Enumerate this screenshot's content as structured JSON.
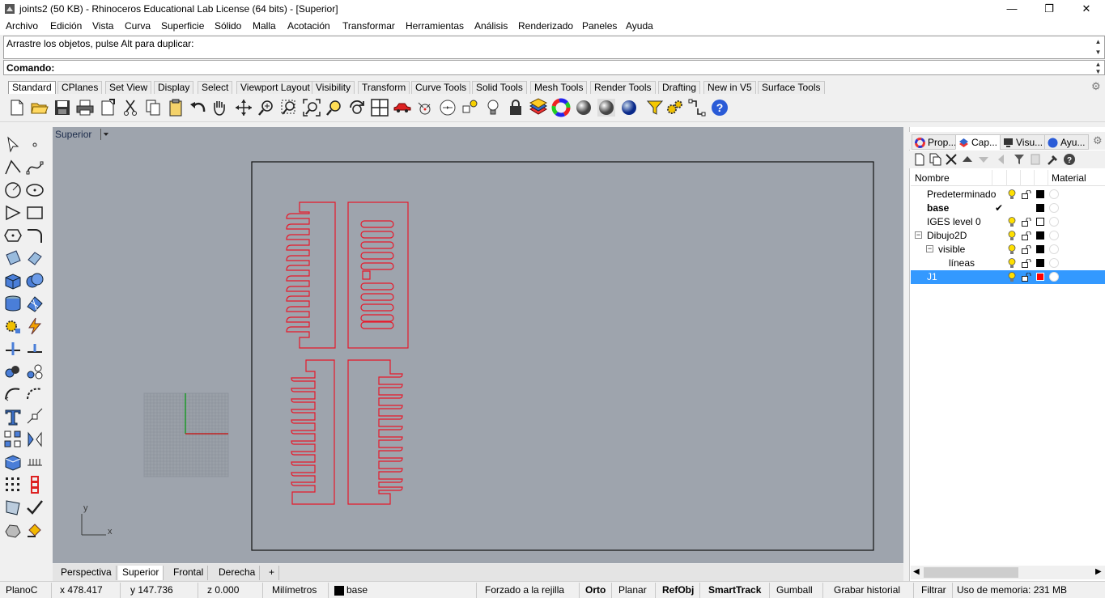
{
  "window": {
    "title": "joints2 (50 KB) - Rhinoceros Educational Lab License (64 bits) - [Superior]",
    "minimize": "—",
    "restore": "❐",
    "close": "✕"
  },
  "menu": [
    "Archivo",
    "Edición",
    "Vista",
    "Curva",
    "Superficie",
    "Sólido",
    "Malla",
    "Acotación",
    "Transformar",
    "Herramientas",
    "Análisis",
    "Renderizado",
    "Paneles",
    "Ayuda"
  ],
  "command": {
    "history": "Arrastre los objetos, pulse Alt para duplicar:",
    "prompt": "Comando:"
  },
  "toolbar_tabs": [
    "Standard",
    "CPlanes",
    "Set View",
    "Display",
    "Select",
    "Viewport Layout",
    "Visibility",
    "Transform",
    "Curve Tools",
    "Solid Tools",
    "Mesh Tools",
    "Render Tools",
    "Drafting",
    "New in V5",
    "Surface Tools"
  ],
  "toolbar_icons": [
    "new-file-icon",
    "open-folder-icon",
    "save-icon",
    "print-icon",
    "import-icon",
    "cut-icon",
    "copy-icon",
    "paste-icon",
    "undo-icon",
    "pan-hand-icon",
    "move-view-icon",
    "zoom-icon",
    "zoom-window-icon",
    "zoom-extents-icon",
    "zoom-selected-icon",
    "rotate-view-icon",
    "four-viewports-icon",
    "car-icon",
    "camera-target-icon",
    "cplane-icon",
    "point-select-icon",
    "light-bulb-icon",
    "lock-icon",
    "layer-icon",
    "color-wheel-icon",
    "shaded-sphere-icon",
    "rendered-sphere-icon",
    "ghosted-sphere-icon",
    "blue-sphere-icon",
    "filter-icon",
    "options-gears-icon",
    "snap-icon",
    "help-icon"
  ],
  "viewport": {
    "name": "Superior",
    "axis_x": "x",
    "axis_y": "y",
    "tabs": [
      "Perspectiva",
      "Superior",
      "Frontal",
      "Derecha"
    ],
    "add_tab": "+"
  },
  "panel": {
    "tabs": [
      "Prop...",
      "Cap...",
      "Visu...",
      "Ayu..."
    ],
    "columns": {
      "name": "Nombre",
      "material": "Material"
    },
    "layers": [
      {
        "name": "Predeterminado",
        "indent": 0,
        "bold": false,
        "color": "#000000",
        "current": false,
        "selected": false
      },
      {
        "name": "base",
        "indent": 0,
        "bold": true,
        "color": "#000000",
        "current": true,
        "selected": false
      },
      {
        "name": "IGES level 0",
        "indent": 0,
        "bold": false,
        "color": "#ffffff",
        "current": false,
        "selected": false
      },
      {
        "name": "Dibujo2D",
        "indent": 0,
        "bold": false,
        "color": "#000000",
        "current": false,
        "selected": false,
        "tree": "⊟"
      },
      {
        "name": "visible",
        "indent": 1,
        "bold": false,
        "color": "#000000",
        "current": false,
        "selected": false,
        "tree": "⊟"
      },
      {
        "name": "líneas",
        "indent": 2,
        "bold": false,
        "color": "#000000",
        "current": false,
        "selected": false
      },
      {
        "name": "J1",
        "indent": 0,
        "bold": false,
        "color": "#ff0000",
        "current": false,
        "selected": true
      }
    ],
    "checkmark": "✔"
  },
  "status": {
    "cplane": "PlanoC",
    "x": "x 478.417",
    "y": "y 147.736",
    "z": "z 0.000",
    "units": "Milímetros",
    "layer": "base",
    "grid_snap": "Forzado a la rejilla",
    "ortho": "Orto",
    "planar": "Planar",
    "osnap": "RefObj",
    "smarttrack": "SmartTrack",
    "gumball": "Gumball",
    "history": "Grabar historial",
    "filter": "Filtrar",
    "memory": "Uso de memoria: 231 MB"
  },
  "colors": {
    "viewport_bg": "#9ea4ad",
    "curve_red": "#e8182a",
    "selection": "#3399ff"
  }
}
